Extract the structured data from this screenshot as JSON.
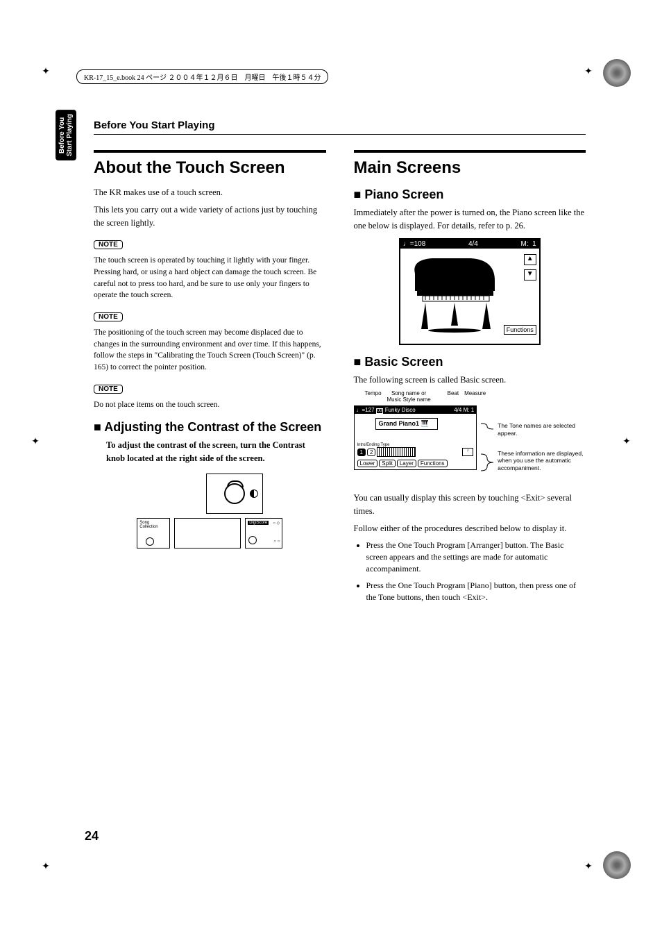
{
  "header_bar": "KR-17_15_e.book  24 ページ  ２００４年１２月６日　月曜日　午後１時５４分",
  "side_tab": "Before You\nStart Playing",
  "section_header": "Before You Start Playing",
  "page_number": "24",
  "left": {
    "h1": "About the Touch Screen",
    "p1": "The KR makes use of a touch screen.",
    "p2": "This lets you carry out a wide variety of actions just by touching the screen lightly.",
    "note_label": "NOTE",
    "note1": "The touch screen is operated by touching it lightly with your finger. Pressing hard, or using a hard object can damage the touch screen. Be careful not to press too hard, and be sure to use only your fingers to operate the touch screen.",
    "note2": "The positioning of the touch screen may become displaced due to changes in the surrounding environment and over time. If this happens, follow the steps in \"Calibrating the Touch Screen (Touch Screen)\" (p. 165) to correct the pointer position.",
    "note3": "Do not place items on the touch screen.",
    "h2": "Adjusting the Contrast of the Screen",
    "contrast_p": "To adjust the contrast of the screen, turn the Contrast knob located at the right side of the screen.",
    "fig_song_collection": "Song\nCollection",
    "fig_digiscore": "DigiScore"
  },
  "right": {
    "h1": "Main Screens",
    "h2a": "Piano Screen",
    "piano_p": "Immediately after the power is turned on, the Piano screen like the one below is displayed. For details, refer to p. 26.",
    "piano_fig": {
      "tempo": "=108",
      "timesig": "4/4",
      "measure_label": "M:",
      "measure": "1",
      "functions": "Functions"
    },
    "h2b": "Basic Screen",
    "basic_p": "The following screen is called Basic screen.",
    "basic_labels": {
      "tempo": "Tempo",
      "songname": "Song name or\nMusic Style name",
      "beat": "Beat",
      "measure": "Measure"
    },
    "basic_fig": {
      "top_left": "=127",
      "style": "Funky Disco",
      "timesig": "4/4",
      "m": "M:",
      "mnum": "1",
      "tone": "Grand Piano1",
      "intro": "Intro/Ending Type",
      "b1": "1",
      "b2": "2",
      "lower": "Lower",
      "split": "Split",
      "layer": "Layer",
      "functions": "Functions"
    },
    "callout1": "The Tone names are selected appear.",
    "callout2": "These information are displayed, when you use the automatic accompaniment.",
    "p_exit": "You can usually display this screen by touching <Exit> several times.",
    "p_follow": "Follow either of the procedures described below to display it.",
    "bullets": [
      "Press the One Touch Program [Arranger] button. The Basic screen appears and the settings are made for automatic accompaniment.",
      "Press the One Touch Program [Piano] button, then press one of the Tone buttons, then touch <Exit>."
    ]
  }
}
